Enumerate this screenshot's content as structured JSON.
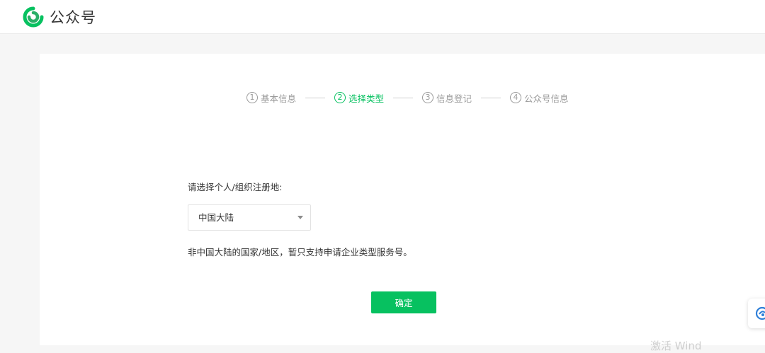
{
  "header": {
    "brand": "公众号",
    "colors": {
      "brand_green": "#07c160",
      "logo_dark_green": "#2aae67"
    }
  },
  "steps": [
    {
      "num": "1",
      "label": "基本信息",
      "active": false
    },
    {
      "num": "2",
      "label": "选择类型",
      "active": true
    },
    {
      "num": "3",
      "label": "信息登记",
      "active": false
    },
    {
      "num": "4",
      "label": "公众号信息",
      "active": false
    }
  ],
  "form": {
    "label": "请选择个人/组织注册地:",
    "select_value": "中国大陆",
    "hint": "非中国大陆的国家/地区，暂只支持申请企业类型服务号。",
    "confirm": "确定"
  },
  "watermark": "激活 Wind",
  "icons": {
    "logo": "wechat-official-account-logo-icon",
    "caret": "caret-down-icon",
    "float": "floating-assistant-icon"
  }
}
